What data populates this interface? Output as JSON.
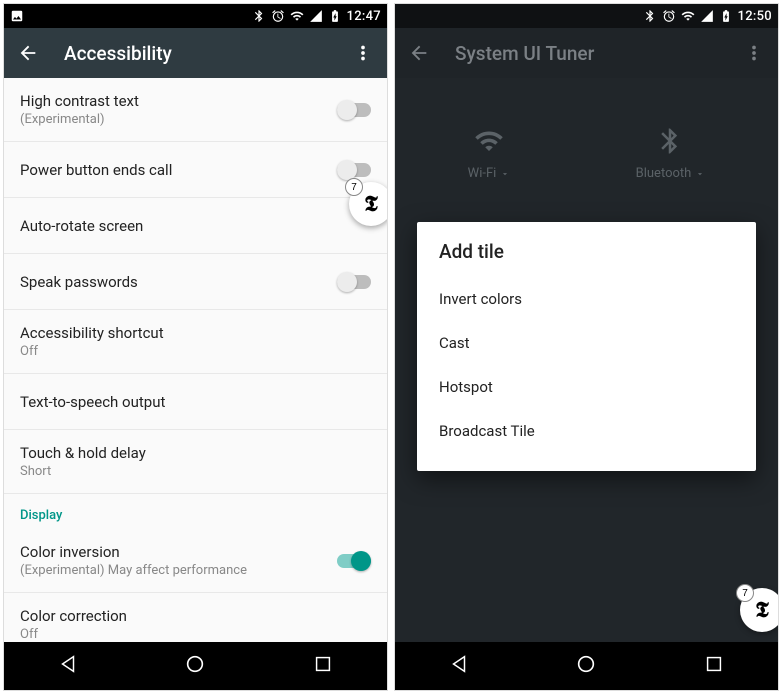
{
  "left": {
    "status": {
      "time": "12:47"
    },
    "app_bar": {
      "title": "Accessibility"
    },
    "rows": [
      {
        "title": "High contrast text",
        "sub": "(Experimental)",
        "switch": "off"
      },
      {
        "title": "Power button ends call",
        "switch": "off"
      },
      {
        "title": "Auto-rotate screen"
      },
      {
        "title": "Speak passwords",
        "switch": "off"
      },
      {
        "title": "Accessibility shortcut",
        "sub": "Off"
      },
      {
        "title": "Text-to-speech output"
      },
      {
        "title": "Touch & hold delay",
        "sub": "Short"
      }
    ],
    "section": "Display",
    "rows2": [
      {
        "title": "Color inversion",
        "sub": "(Experimental) May affect performance",
        "switch": "on"
      },
      {
        "title": "Color correction",
        "sub": "Off"
      }
    ],
    "badge_count": "7"
  },
  "right": {
    "status": {
      "time": "12:50"
    },
    "app_bar": {
      "title": "System UI Tuner"
    },
    "tiles": [
      {
        "label": "Wi-Fi"
      },
      {
        "label": "Bluetooth"
      }
    ],
    "add_hint": "Add tile",
    "dialog": {
      "title": "Add tile",
      "items": [
        "Invert colors",
        "Cast",
        "Hotspot",
        "Broadcast Tile"
      ]
    },
    "badge_count": "7"
  },
  "colors": {
    "accent": "#009688"
  }
}
